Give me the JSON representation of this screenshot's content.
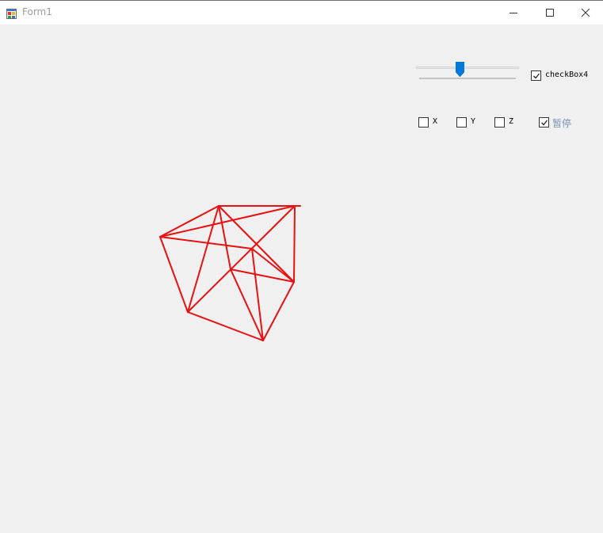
{
  "window": {
    "title": "Form1"
  },
  "trackbar": {
    "value_fraction": 0.42
  },
  "checkboxes": {
    "checkbox4": {
      "label": "checkBox4",
      "checked": true
    },
    "x": {
      "label": "X",
      "checked": false
    },
    "y": {
      "label": "Y",
      "checked": false
    },
    "z": {
      "label": "Z",
      "checked": false
    },
    "pause": {
      "label": "暂停",
      "checked": true,
      "label_color": "#7a93b8"
    }
  },
  "drawing": {
    "stroke_color": "#e81010"
  },
  "colors": {
    "window_bg": "#f0f0f0",
    "accent": "#0078d7"
  }
}
